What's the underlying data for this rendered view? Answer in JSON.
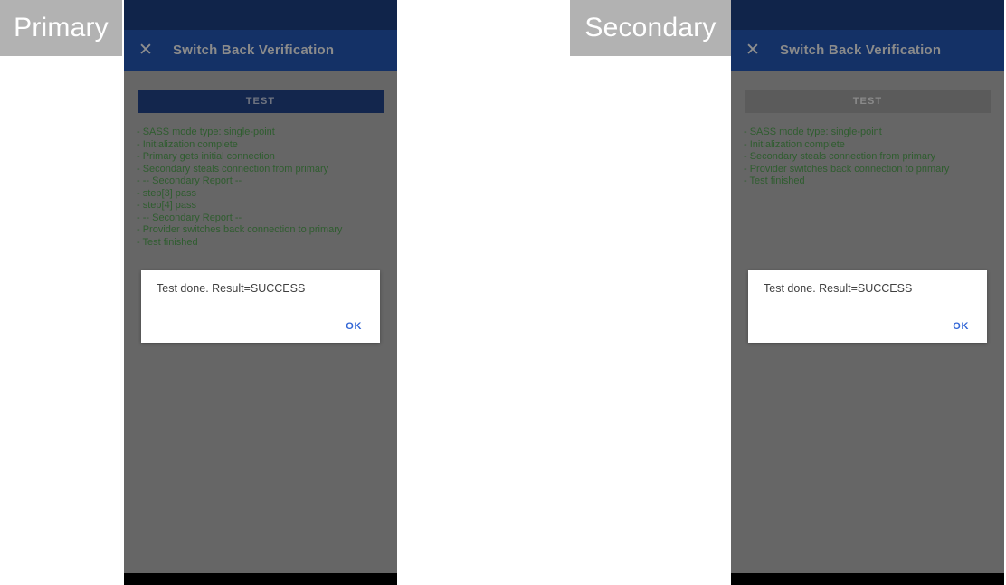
{
  "annotations": {
    "primary": "Primary",
    "secondary": "Secondary"
  },
  "devices": [
    {
      "key": "primary",
      "app_bar": {
        "close_icon": "close-icon",
        "title": "Switch Back Verification"
      },
      "test_button": {
        "label": "TEST",
        "enabled": true
      },
      "log_lines": [
        "- SASS mode type: single-point",
        "- Initialization complete",
        "- Primary gets initial connection",
        "- Secondary steals connection from primary",
        "- -- Secondary Report --",
        "- step[3] pass",
        "- step[4] pass",
        "- -- Secondary Report --",
        "- Provider switches back connection to primary",
        "- Test finished"
      ],
      "dialog": {
        "message": "Test done. Result=SUCCESS",
        "ok_label": "OK"
      }
    },
    {
      "key": "secondary",
      "app_bar": {
        "close_icon": "close-icon",
        "title": "Switch Back Verification"
      },
      "test_button": {
        "label": "TEST",
        "enabled": false
      },
      "log_lines": [
        "- SASS mode type: single-point",
        "- Initialization complete",
        "- Secondary steals connection from primary",
        "- Provider switches back connection to primary",
        "- Test finished"
      ],
      "dialog": {
        "message": "Test done. Result=SUCCESS",
        "ok_label": "OK"
      }
    }
  ],
  "colors": {
    "status_bar": "#10244a",
    "app_bar": "#143166",
    "screen_background": "#666666",
    "log_text": "#2f5d2f",
    "dialog_action": "#3367d6",
    "annotation_background": "#b2b2b2",
    "nav_bar": "#000000"
  }
}
